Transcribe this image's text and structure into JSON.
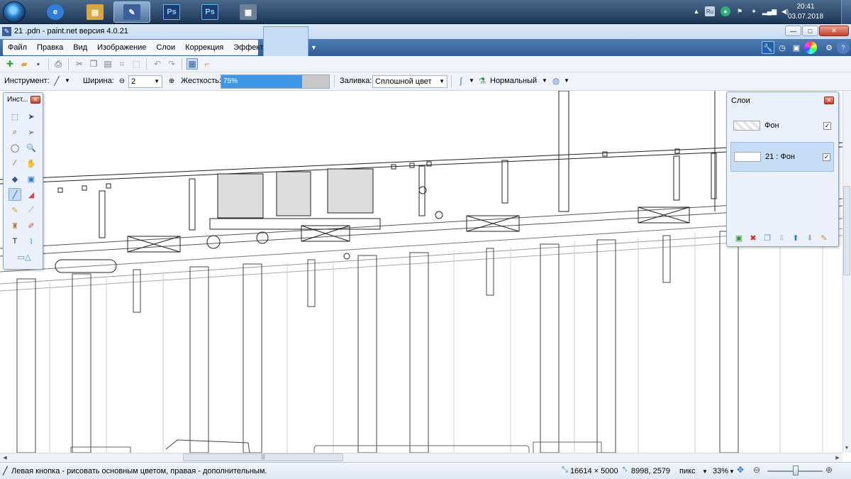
{
  "taskbar": {
    "apps": [
      {
        "name": "internet-explorer",
        "icon": "e",
        "color": "#2f7fd8"
      },
      {
        "name": "file-explorer",
        "icon": "▤",
        "color": "#d9a640"
      },
      {
        "name": "paint-net",
        "icon": "✎",
        "color": "#3a5f9b",
        "active": true
      },
      {
        "name": "photoshop-1",
        "icon": "Ps",
        "color": "#1f3c6e"
      },
      {
        "name": "photoshop-2",
        "icon": "Ps",
        "color": "#1f3c6e"
      },
      {
        "name": "calculator",
        "icon": "▦",
        "color": "#6d7f99"
      }
    ],
    "tray": {
      "language": "Ru",
      "time": "20:41",
      "date": "03.07.2018"
    }
  },
  "window": {
    "title": "21 .pdn - paint.net версия 4.0.21",
    "controls": {
      "minimize": "—",
      "maximize": "□",
      "close": "✕"
    }
  },
  "menu": {
    "items": [
      "Файл",
      "Правка",
      "Вид",
      "Изображение",
      "Слои",
      "Коррекция",
      "Эффекты"
    ]
  },
  "toolbar2": {
    "tool_label": "Инструмент:",
    "width_label": "Ширина:",
    "width_value": "2",
    "hardness_label": "Жесткость:",
    "hardness_value": "75%",
    "hardness_fraction": 0.75,
    "fill_label": "Заливка:",
    "fill_value": "Сплошной цвет",
    "blend_value": "Нормальный"
  },
  "tools_panel": {
    "title": "Инст..."
  },
  "layers_panel": {
    "title": "Слои",
    "layers": [
      {
        "name": "Фон",
        "visible": true,
        "selected": false
      },
      {
        "name": "21 : Фон",
        "visible": true,
        "selected": true
      }
    ]
  },
  "status": {
    "hint": "Левая кнопка - рисовать основным цветом, правая - дополнительным.",
    "image_size": "16614 × 5000",
    "cursor_pos": "8998, 2579",
    "units": "пикс",
    "zoom": "33%"
  },
  "colors": {
    "accent": "#3d97e8",
    "menubar": "#2f5e96"
  }
}
